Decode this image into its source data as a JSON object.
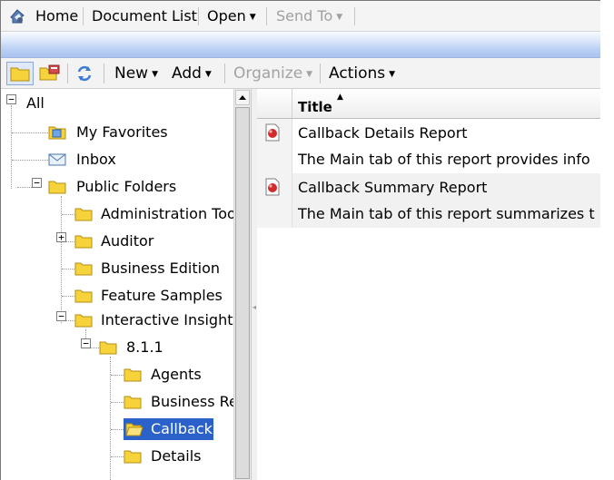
{
  "topnav": {
    "home": "Home",
    "document_list": "Document List",
    "open": "Open",
    "send_to": "Send To"
  },
  "toolbar": {
    "new": "New",
    "add": "Add",
    "organize": "Organize",
    "actions": "Actions"
  },
  "tree": {
    "root": "All",
    "my_favorites": "My Favorites",
    "inbox": "Inbox",
    "public_folders": "Public Folders",
    "administration_tools": "Administration Too",
    "auditor": "Auditor",
    "business_edition": "Business Edition",
    "feature_samples": "Feature Samples",
    "interactive_insight": "Interactive Insight",
    "version": "8.1.1",
    "agents": "Agents",
    "business_re": "Business Re",
    "callback": "Callback",
    "details": "Details"
  },
  "list": {
    "column_title": "Title",
    "rows": [
      {
        "title": "Callback Details Report",
        "description": "The Main tab of this report provides info"
      },
      {
        "title": "Callback Summary Report",
        "description": "The Main tab of this report summarizes t"
      }
    ]
  },
  "colors": {
    "selection": "#2a62c9",
    "folder": "#f7d33b",
    "band": "#b9cff4"
  }
}
